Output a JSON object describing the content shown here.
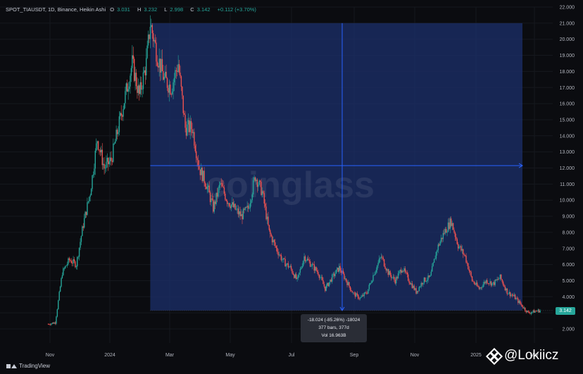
{
  "header": {
    "symbol": "SPOT_TIAUSDT, 1D, Binance, Heikin Ashi",
    "o_label": "O",
    "o": "3.031",
    "h_label": "H",
    "h": "3.232",
    "l_label": "L",
    "l": "2.998",
    "c_label": "C",
    "c": "3.142",
    "change": "+0.112 (+3.70%)"
  },
  "watermark": "coinglass",
  "price_tag": "3.142",
  "measure": {
    "line1": "-18.024 (-85.26%) -18024",
    "line2": "377 bars, 377d",
    "line3": "Vol 16.963B"
  },
  "footer": {
    "brand": "TradingView"
  },
  "handle": "@Lokiicz",
  "colors": {
    "up": "#26a69a",
    "down": "#ef5350",
    "measure_fill": "#1c2f6b",
    "crosshair": "#2962ff"
  },
  "chart_data": {
    "type": "candlestick",
    "title": "SPOT_TIAUSDT, 1D, Binance, Heikin Ashi",
    "ylim": [
      1.5,
      22
    ],
    "y_ticks": [
      "2.000",
      "3.000",
      "4.000",
      "5.000",
      "6.000",
      "7.000",
      "8.000",
      "9.000",
      "10.000",
      "11.000",
      "12.000",
      "13.000",
      "14.000",
      "15.000",
      "16.000",
      "17.000",
      "18.000",
      "19.000",
      "20.000",
      "21.000",
      "22.000"
    ],
    "x_ticks": [
      "Nov",
      "2024",
      "Mar",
      "May",
      "Jul",
      "Sep",
      "Nov",
      "2025",
      "Mar"
    ],
    "path": [
      [
        "2023-10-31",
        2.3
      ],
      [
        "2023-11-07",
        2.4
      ],
      [
        "2023-11-14",
        5.5
      ],
      [
        "2023-11-21",
        6.3
      ],
      [
        "2023-11-28",
        6.0
      ],
      [
        "2023-12-05",
        8.5
      ],
      [
        "2023-12-12",
        10.5
      ],
      [
        "2023-12-19",
        13.8
      ],
      [
        "2023-12-26",
        12.0
      ],
      [
        "2024-01-02",
        12.5
      ],
      [
        "2024-01-09",
        14.5
      ],
      [
        "2024-01-16",
        16.5
      ],
      [
        "2024-01-23",
        18.5
      ],
      [
        "2024-01-30",
        16.5
      ],
      [
        "2024-02-06",
        18.5
      ],
      [
        "2024-02-10",
        21.0
      ],
      [
        "2024-02-17",
        19.0
      ],
      [
        "2024-02-24",
        17.5
      ],
      [
        "2024-03-02",
        17.0
      ],
      [
        "2024-03-09",
        18.5
      ],
      [
        "2024-03-16",
        14.5
      ],
      [
        "2024-03-23",
        14.5
      ],
      [
        "2024-03-30",
        12.0
      ],
      [
        "2024-04-06",
        11.0
      ],
      [
        "2024-04-13",
        9.5
      ],
      [
        "2024-04-20",
        11.0
      ],
      [
        "2024-04-27",
        10.0
      ],
      [
        "2024-05-04",
        9.5
      ],
      [
        "2024-05-11",
        9.0
      ],
      [
        "2024-05-18",
        9.5
      ],
      [
        "2024-05-25",
        11.5
      ],
      [
        "2024-06-01",
        10.5
      ],
      [
        "2024-06-08",
        8.0
      ],
      [
        "2024-06-15",
        7.0
      ],
      [
        "2024-06-22",
        6.2
      ],
      [
        "2024-06-29",
        5.8
      ],
      [
        "2024-07-06",
        5.0
      ],
      [
        "2024-07-13",
        6.5
      ],
      [
        "2024-07-20",
        6.0
      ],
      [
        "2024-07-27",
        5.5
      ],
      [
        "2024-08-03",
        4.5
      ],
      [
        "2024-08-10",
        5.2
      ],
      [
        "2024-08-17",
        5.8
      ],
      [
        "2024-08-24",
        5.0
      ],
      [
        "2024-08-31",
        4.2
      ],
      [
        "2024-09-07",
        3.9
      ],
      [
        "2024-09-14",
        4.3
      ],
      [
        "2024-09-21",
        5.5
      ],
      [
        "2024-09-28",
        6.5
      ],
      [
        "2024-10-05",
        5.5
      ],
      [
        "2024-10-12",
        5.0
      ],
      [
        "2024-10-19",
        5.8
      ],
      [
        "2024-10-26",
        5.0
      ],
      [
        "2024-11-02",
        4.3
      ],
      [
        "2024-11-09",
        5.0
      ],
      [
        "2024-11-16",
        5.2
      ],
      [
        "2024-11-23",
        7.0
      ],
      [
        "2024-11-30",
        8.0
      ],
      [
        "2024-12-07",
        8.7
      ],
      [
        "2024-12-14",
        7.2
      ],
      [
        "2024-12-21",
        6.5
      ],
      [
        "2024-12-28",
        5.0
      ],
      [
        "2025-01-04",
        4.5
      ],
      [
        "2025-01-11",
        5.0
      ],
      [
        "2025-01-18",
        4.8
      ],
      [
        "2025-01-25",
        5.2
      ],
      [
        "2025-02-01",
        4.3
      ],
      [
        "2025-02-08",
        4.0
      ],
      [
        "2025-02-15",
        3.5
      ],
      [
        "2025-02-22",
        3.0
      ],
      [
        "2025-03-01",
        3.1
      ],
      [
        "2025-03-06",
        3.142
      ]
    ],
    "measure_range": {
      "start": "2024-02-10",
      "end": "2025-03-06",
      "high": 21.0,
      "low": 3.142
    },
    "crosshair": {
      "date": "2024-08-20",
      "price": 12.15
    }
  }
}
